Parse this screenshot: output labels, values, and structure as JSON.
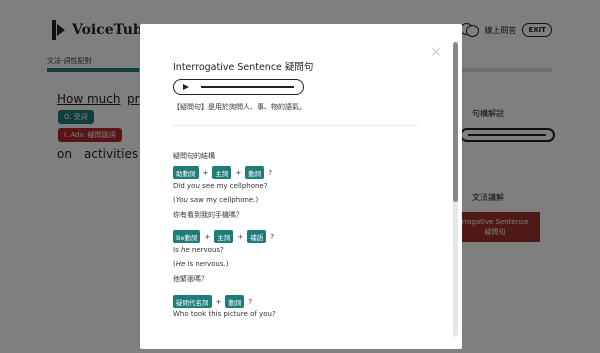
{
  "app": {
    "logo_text": "VoiceTube"
  },
  "header": {
    "online_qa": "線上問答",
    "exit_label": "EXIT"
  },
  "breadcrumb": "文法-詞性配對",
  "background": {
    "words": [
      "How much",
      "pr",
      "on",
      "activities"
    ],
    "tags": [
      "O. 受詞",
      "I. Adv. 疑問副詞"
    ],
    "side_title_1": "句構解說",
    "side_title_2": "文法講解",
    "grammar_box_line1": "rrogative Sentence",
    "grammar_box_line2": "疑問句"
  },
  "modal": {
    "title": "Interrogative Sentence 疑問句",
    "description": "【疑問句】是用於詢問人、事、物的語氣。",
    "section_title": "疑問句的結構",
    "patterns": [
      {
        "parts": [
          "助動詞",
          "+",
          "主詞",
          "+",
          "動詞",
          "?"
        ],
        "examples": [
          {
            "pre": "Did ",
            "em": "you",
            "post": " see my cellphone?"
          },
          {
            "pre": "(",
            "em": "You",
            "post": " saw my cellphone.)"
          },
          {
            "pre": "你有看到我的手機嗎？",
            "em": "",
            "post": ""
          }
        ]
      },
      {
        "parts": [
          "Be動詞",
          "+",
          "主詞",
          "+",
          "補語",
          "?"
        ],
        "examples": [
          {
            "pre": "Is ",
            "em": "he",
            "post": " nervous?"
          },
          {
            "pre": "(",
            "em": "He",
            "post": " is nervous.)"
          },
          {
            "pre": "他緊張嗎？",
            "em": "",
            "post": ""
          }
        ]
      },
      {
        "parts": [
          "疑問代名詞",
          "+",
          "動詞",
          "?"
        ],
        "examples": [
          {
            "pre": "Who took this picture of you?",
            "em": "",
            "post": ""
          }
        ]
      }
    ]
  },
  "colors": {
    "teal": "#1e7d78",
    "red": "#b22a2a",
    "overlay": "rgba(0,0,0,0.5)"
  }
}
